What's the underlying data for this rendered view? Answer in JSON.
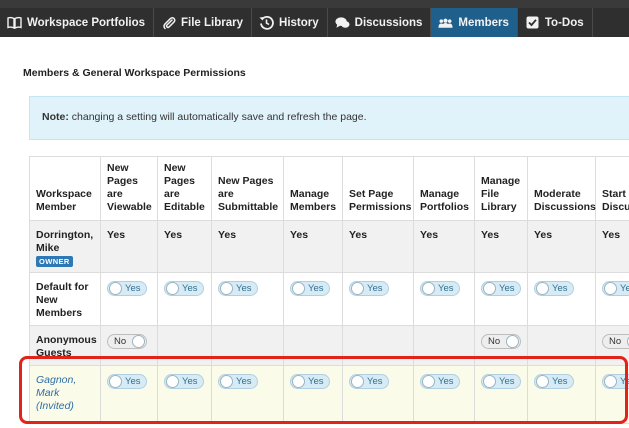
{
  "tabs": [
    {
      "label": "Workspace Portfolios",
      "icon": "book-icon",
      "active": false
    },
    {
      "label": "File Library",
      "icon": "paperclip-icon",
      "active": false
    },
    {
      "label": "History",
      "icon": "history-icon",
      "active": false
    },
    {
      "label": "Discussions",
      "icon": "speech-bubbles-icon",
      "active": false
    },
    {
      "label": "Members",
      "icon": "members-icon",
      "active": true
    },
    {
      "label": "To-Dos",
      "icon": "checkbox-icon",
      "active": false
    }
  ],
  "section_title": "Members & General Workspace Permissions",
  "note": {
    "label": "Note:",
    "text": " changing a setting will automatically save and refresh the page."
  },
  "columns": [
    "Workspace Member",
    "New Pages are Viewable",
    "New Pages are Editable",
    "New Pages are Submittable",
    "Manage Members",
    "Set Page Permissions",
    "Manage Portfolios",
    "Manage File Library",
    "Moderate Discussions",
    "Start Discussions"
  ],
  "rows": [
    {
      "member": "Dorrington, Mike",
      "badge": "OWNER",
      "cells": [
        "Yes",
        "Yes",
        "Yes",
        "Yes",
        "Yes",
        "Yes",
        "Yes",
        "Yes",
        "Yes"
      ]
    },
    {
      "member": "Default for New Members",
      "cells": [
        "Yes",
        "Yes",
        "Yes",
        "Yes",
        "Yes",
        "Yes",
        "Yes",
        "Yes",
        "Yes"
      ]
    },
    {
      "member": "Anonymous Guests",
      "cells": [
        "No",
        "",
        "",
        "",
        "",
        "",
        "No",
        "",
        "No"
      ]
    },
    {
      "member": "Gagnon, Mark (Invited)",
      "cells": [
        "Yes",
        "Yes",
        "Yes",
        "Yes",
        "Yes",
        "Yes",
        "Yes",
        "Yes",
        "Yes"
      ]
    }
  ],
  "colors": {
    "tabbar": "#2f2f2f",
    "active_tab": "#1f5f8b",
    "note_bg": "#e1f3fa",
    "highlight": "#e2231a",
    "owner_badge": "#2e78b6"
  }
}
